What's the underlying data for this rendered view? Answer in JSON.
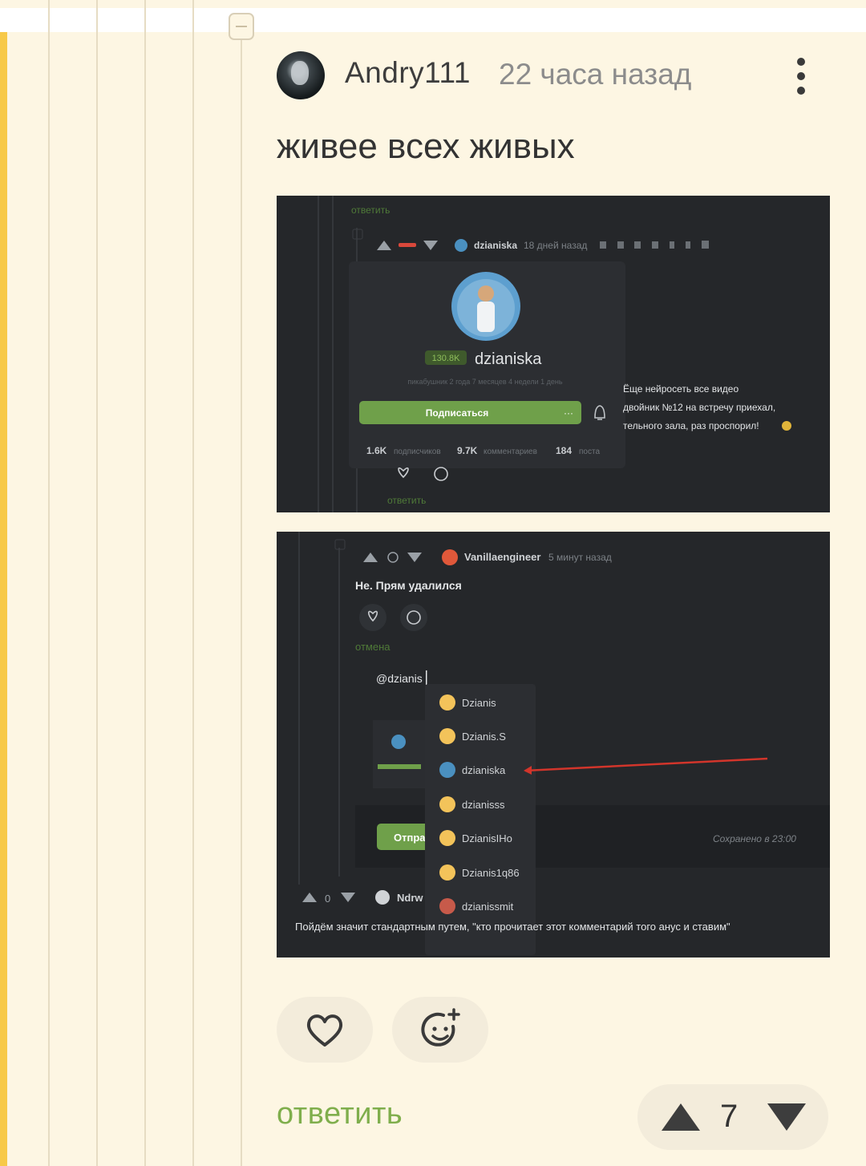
{
  "comment": {
    "author": "Andry111",
    "time_ago": "22 часа назад",
    "text": "живее всех живых",
    "reply_label": "ответить",
    "rating": "7"
  },
  "screenshot1": {
    "reply_top": "ответить",
    "username": "dzianiska",
    "time_ago": "18 дней назад",
    "rating_badge": "130.8K",
    "pikabu_age": "пикабушник 2 года 7 месяцев 4 недели 1 день",
    "subscribe_button": "Подписаться",
    "more": "···",
    "stats": [
      "1.6K",
      "подписчиков",
      "9.7K",
      "комментариев",
      "184",
      "поста"
    ],
    "side_text": [
      "Ёще нейросеть все видео",
      "двойник №12 на встречу приехал,",
      "тельного зала, раз проспорил!"
    ],
    "reply_bottom": "ответить"
  },
  "screenshot2": {
    "username": "Vanillaengineer",
    "time_ago": "5 минут назад",
    "message": "Не. Прям удалился",
    "cancel": "отмена",
    "input_text": "@dzianis",
    "suggestions": [
      "Dzianis",
      "Dzianis.S",
      "dzianiska",
      "dzianisss",
      "DzianisIHo",
      "Dzianis1q86",
      "dzianissmit"
    ],
    "send_button": "Отпра",
    "saved_status": "Сохранено в 23:00",
    "vote_count": "0",
    "next_user": "Ndrw",
    "next_comment": "Пойдём значит стандартным путем, \"кто прочитает этот комментарий того анус и ставим\""
  },
  "colors": {
    "background": "#fdf6e3",
    "accent_green": "#7fae4c",
    "thread_line": "#e6dcc3",
    "left_edge": "#f7c948",
    "dark_bg": "#25272a"
  },
  "icons": [
    "collapse-icon",
    "more-vert-icon",
    "heart-icon",
    "emoji-add-icon",
    "arrow-up-icon",
    "arrow-down-icon"
  ]
}
